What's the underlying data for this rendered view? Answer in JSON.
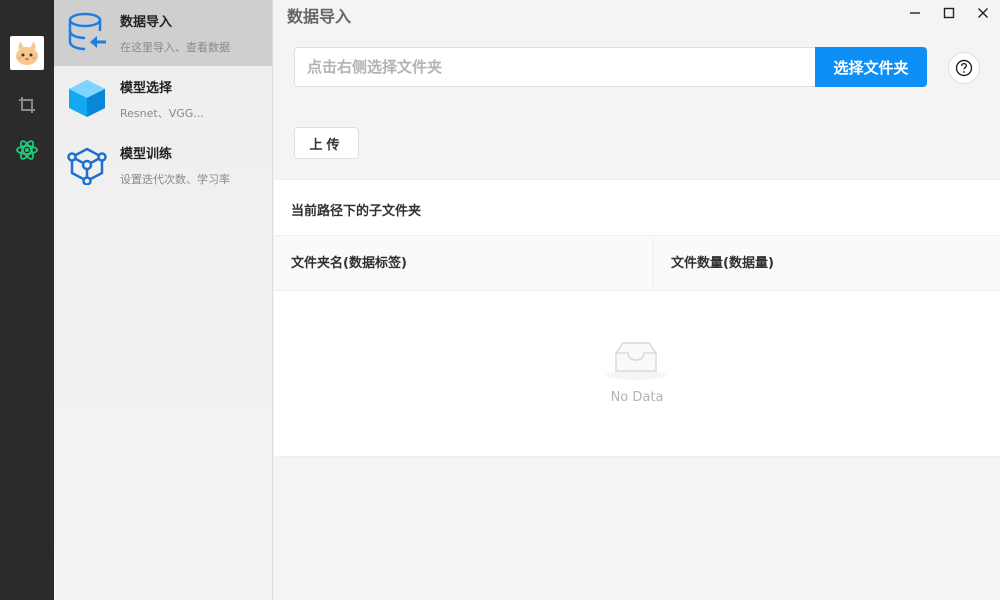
{
  "rail": {
    "items": [
      {
        "name": "avatar"
      },
      {
        "name": "crop-icon"
      },
      {
        "name": "atom-icon"
      }
    ]
  },
  "nav": {
    "items": [
      {
        "title": "数据导入",
        "subtitle": "在这里导入、查看数据",
        "icon": "database-import-icon"
      },
      {
        "title": "模型选择",
        "subtitle": "Resnet、VGG...",
        "icon": "cube-icon"
      },
      {
        "title": "模型训练",
        "subtitle": "设置迭代次数、学习率",
        "icon": "network-icon"
      }
    ]
  },
  "window": {
    "title": "数据导入",
    "minimize": "—",
    "maximize": "☐",
    "close": "✕"
  },
  "toolbar": {
    "path_placeholder": "点击右侧选择文件夹",
    "path_value": "",
    "choose_label": "选择文件夹",
    "help_label": "?",
    "upload_label": "上传"
  },
  "table": {
    "caption": "当前路径下的子文件夹",
    "columns": [
      "文件夹名(数据标签)",
      "文件数量(数据量)"
    ],
    "rows": [],
    "empty_text": "No Data"
  },
  "colors": {
    "accent": "#0d8ff5",
    "rail_bg": "#2b2b2b",
    "active_nav": "#cfcfcf"
  }
}
